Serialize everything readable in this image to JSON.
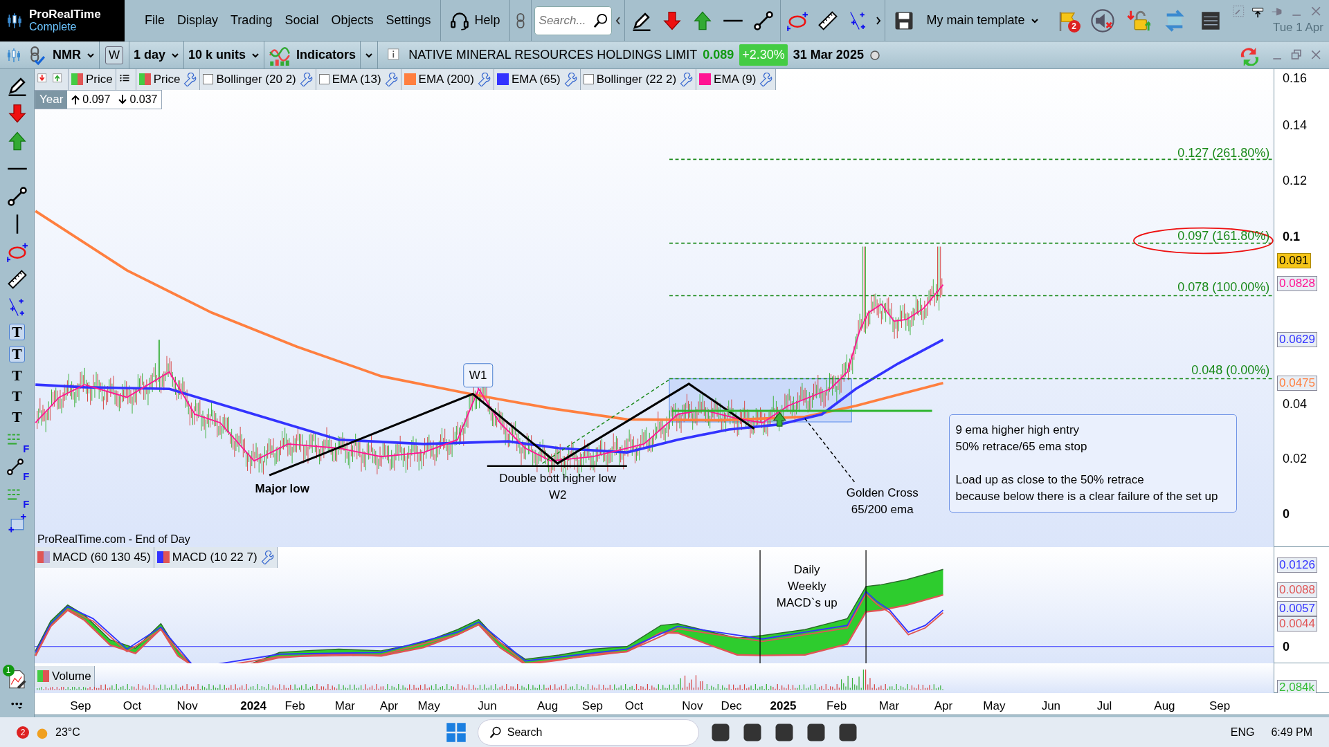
{
  "app": {
    "name": "ProRealTime",
    "edition": "Complete"
  },
  "menu": [
    "File",
    "Display",
    "Trading",
    "Social",
    "Objects",
    "Settings"
  ],
  "help": "Help",
  "search": {
    "placeholder": "Search..."
  },
  "template": "My main template",
  "alerts_count": "2",
  "date": "Tue 1 Apr",
  "instrument": {
    "symbol": "NMR",
    "weekly": "W",
    "period": "1 day",
    "units": "10 k units",
    "indicators": "Indicators",
    "name": "NATIVE MINERAL RESOURCES HOLDINGS LIMIT",
    "price": "0.089",
    "change": "+2.30%",
    "date": "31 Mar 2025"
  },
  "tool_letters": {
    "text": [
      "T",
      "T",
      "T",
      "T",
      "T"
    ],
    "fib": [
      "F",
      "F",
      "F"
    ],
    "badge": "1"
  },
  "legend": [
    {
      "kind": "price",
      "label": "Price",
      "wrench": false
    },
    {
      "kind": "price",
      "label": "Price",
      "wrench": true
    },
    {
      "kind": "checkbox",
      "checked": false,
      "label": "Bollinger (20 2)",
      "wrench": true
    },
    {
      "kind": "checkbox",
      "checked": false,
      "label": "EMA (13)",
      "wrench": true
    },
    {
      "kind": "color",
      "label": "EMA (200)",
      "color": "#ff7f3f",
      "wrench": true
    },
    {
      "kind": "color",
      "label": "EMA (65)",
      "color": "#3333ff",
      "wrench": true
    },
    {
      "kind": "checkbox",
      "checked": false,
      "label": "Bollinger (22 2)",
      "wrench": true
    },
    {
      "kind": "color",
      "label": "EMA (9)",
      "color": "#ff1493",
      "wrench": true
    }
  ],
  "range": {
    "label": "Year",
    "high": "0.097",
    "low": "0.037"
  },
  "price_axis": {
    "ticks": [
      {
        "text": "0.16",
        "bold": false
      },
      {
        "text": "0.14",
        "bold": false
      },
      {
        "text": "0.12",
        "bold": false
      },
      {
        "text": "0.1",
        "bold": true
      },
      {
        "text": "0.04",
        "bold": false
      },
      {
        "text": "0.02",
        "bold": false
      },
      {
        "text": "0",
        "bold": true
      }
    ],
    "tags": [
      {
        "text": "0.091",
        "kind": "last",
        "color": "#f5c518"
      },
      {
        "text": "0.0828",
        "kind": "line",
        "color": "#ff1493"
      },
      {
        "text": "0.0629",
        "kind": "line",
        "color": "#3333ff"
      },
      {
        "text": "0.0475",
        "kind": "line",
        "color": "#ff7f3f"
      }
    ]
  },
  "annotations": {
    "fib_levels": [
      "0.127 (261.80%)",
      "0.097 (161.80%)",
      "0.078 (100.00%)",
      "0.048 (0.00%)"
    ],
    "wave_label": "W1",
    "major_low": "Major low",
    "double_bottom": [
      "Double bott higher low",
      "W2"
    ],
    "golden_cross": [
      "Golden Cross",
      "65/200 ema"
    ],
    "note": [
      [
        "9 ema higher high entry",
        "50% retrace/65 ema stop"
      ],
      [
        "Load up as close to the 50% retrace",
        "because below there is a clear failure of the set up"
      ]
    ]
  },
  "source": "ProRealTime.com - End of Day",
  "macd": {
    "legend": [
      {
        "label": "MACD (60 130 45)",
        "swatches": [
          {
            "color": "#e05555"
          },
          {
            "color": "#b0a0d0"
          }
        ],
        "wrench": false
      },
      {
        "label": "MACD (10 22 7)",
        "swatches": [
          {
            "color": "#3333ff"
          },
          {
            "color": "#e05555"
          }
        ],
        "wrench": true
      }
    ],
    "note": [
      "Daily",
      "Weekly",
      "MACD`s up"
    ],
    "ticks": [
      {
        "text": "0",
        "bold": true
      }
    ],
    "tags": [
      {
        "text": "0.0126",
        "color": "#3333ff"
      },
      {
        "text": "0.0088",
        "color": "#e05555"
      },
      {
        "text": "0.0057",
        "color": "#3333ff"
      },
      {
        "text": "0.0044",
        "color": "#e05555"
      }
    ]
  },
  "volume": {
    "label": "Volume",
    "tags": [
      {
        "text": "2,084k",
        "color": "#33bb33"
      }
    ]
  },
  "months": [
    {
      "text": "Sep",
      "bold": false
    },
    {
      "text": "Oct",
      "bold": false
    },
    {
      "text": "Nov",
      "bold": false
    },
    {
      "text": "2024",
      "bold": true
    },
    {
      "text": "Feb",
      "bold": false
    },
    {
      "text": "Mar",
      "bold": false
    },
    {
      "text": "Apr",
      "bold": false
    },
    {
      "text": "May",
      "bold": false
    },
    {
      "text": "Jun",
      "bold": false
    },
    {
      "text": "Aug",
      "bold": false
    },
    {
      "text": "Sep",
      "bold": false
    },
    {
      "text": "Oct",
      "bold": false
    },
    {
      "text": "Nov",
      "bold": false
    },
    {
      "text": "Dec",
      "bold": false
    },
    {
      "text": "2025",
      "bold": true
    },
    {
      "text": "Feb",
      "bold": false
    },
    {
      "text": "Mar",
      "bold": false
    },
    {
      "text": "Apr",
      "bold": false
    },
    {
      "text": "May",
      "bold": false
    },
    {
      "text": "Jun",
      "bold": false
    },
    {
      "text": "Jul",
      "bold": false
    },
    {
      "text": "Aug",
      "bold": false
    },
    {
      "text": "Sep",
      "bold": false
    }
  ],
  "taskbar": {
    "notifications": "2",
    "weather": "23°C",
    "search": "Search",
    "language": "ENG",
    "time": "6:49 PM"
  }
}
